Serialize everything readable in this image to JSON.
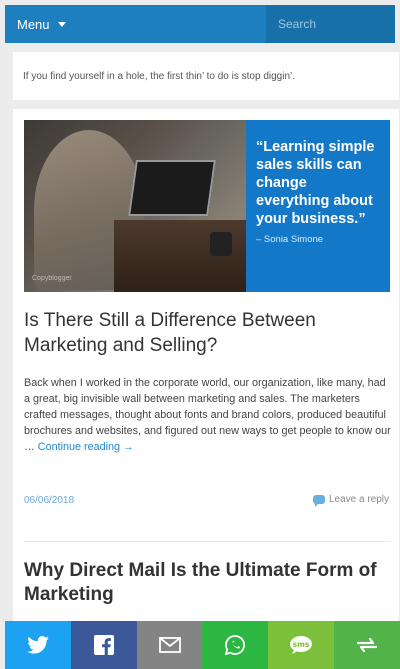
{
  "header": {
    "menu_label": "Menu",
    "search_placeholder": "Search"
  },
  "quote_widget": {
    "text": "If you find yourself in a hole, the first thin’ to do is stop diggin’."
  },
  "post1": {
    "hero": {
      "quote": "“Learning simple sales skills can change everything about your business.”",
      "author": "– Sonia Simone",
      "credit": "Copyblogger",
      "panel_color": "#1478c8"
    },
    "title": "Is There Still a Difference Between Marketing and Selling?",
    "excerpt": "Back when I worked in the corporate world, our organization, like many, had a great, big invisible wall between marketing and sales. The marketers crafted messages, thought about fonts and brand colors, produced beautiful brochures and websites, and figured out new ways to get people to know our … ",
    "continue_label": "Continue reading →",
    "date": "06/06/2018",
    "reply_label": "Leave a reply"
  },
  "post2": {
    "title": "Why Direct Mail Is the Ultimate Form of Marketing"
  },
  "share_bar": {
    "buttons": [
      {
        "name": "twitter",
        "icon": "twitter-icon",
        "color": "#1da1f2"
      },
      {
        "name": "facebook",
        "icon": "facebook-icon",
        "color": "#3b5998"
      },
      {
        "name": "email",
        "icon": "mail-icon",
        "color": "#848484"
      },
      {
        "name": "whatsapp",
        "icon": "whatsapp-icon",
        "color": "#2cb742"
      },
      {
        "name": "sms",
        "icon": "sms-icon",
        "color": "#7bbf3a"
      },
      {
        "name": "more",
        "icon": "share-more-icon",
        "color": "#51b34a"
      }
    ]
  },
  "colors": {
    "header_bg": "#1e7fbf",
    "link": "#1e88d0"
  }
}
